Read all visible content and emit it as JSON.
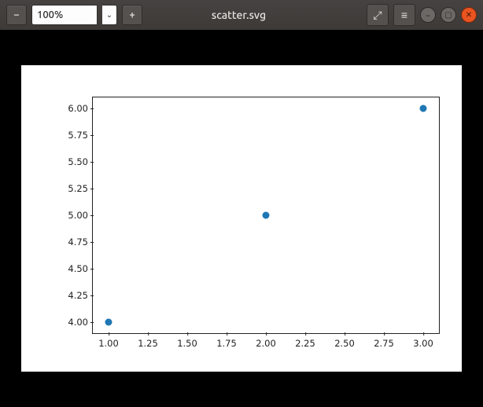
{
  "window": {
    "title": "scatter.svg"
  },
  "toolbar": {
    "zoom_value": "100%",
    "zoom_out_tooltip": "Zoom out",
    "zoom_in_tooltip": "Zoom in"
  },
  "chart_data": {
    "type": "scatter",
    "x": [
      1,
      2,
      3
    ],
    "y": [
      4,
      5,
      6
    ],
    "xlabel": "",
    "ylabel": "",
    "title": "",
    "xlim": [
      0.9,
      3.1
    ],
    "ylim": [
      3.9,
      6.1
    ],
    "xticks": [
      1.0,
      1.25,
      1.5,
      1.75,
      2.0,
      2.25,
      2.5,
      2.75,
      3.0
    ],
    "yticks": [
      4.0,
      4.25,
      4.5,
      4.75,
      5.0,
      5.25,
      5.5,
      5.75,
      6.0
    ],
    "xtick_labels": [
      "1.00",
      "1.25",
      "1.50",
      "1.75",
      "2.00",
      "2.25",
      "2.50",
      "2.75",
      "3.00"
    ],
    "ytick_labels": [
      "4.00",
      "4.25",
      "4.50",
      "4.75",
      "5.00",
      "5.25",
      "5.50",
      "5.75",
      "6.00"
    ],
    "point_color": "#1f77b4"
  }
}
